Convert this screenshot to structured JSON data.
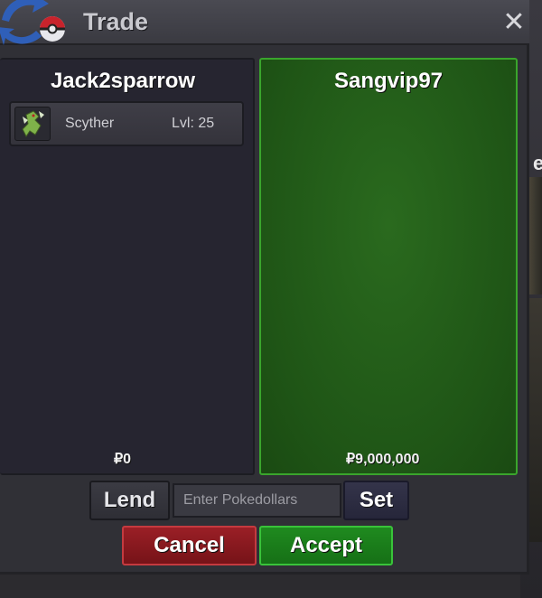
{
  "window": {
    "title": "Trade",
    "close_icon": "close-icon"
  },
  "trade": {
    "left": {
      "player": "Jack2sparrow",
      "items": [
        {
          "icon": "scyther-sprite-icon",
          "name": "Scyther",
          "level": "Lvl: 25"
        }
      ],
      "money": "₽0"
    },
    "right": {
      "player": "Sangvip97",
      "items": [],
      "money": "₽9,000,000"
    }
  },
  "controls": {
    "lend_label": "Lend",
    "money_placeholder": "Enter Pokedollars",
    "set_label": "Set",
    "cancel_label": "Cancel",
    "accept_label": "Accept"
  },
  "peek": {
    "char": "e"
  },
  "colors": {
    "accept_green": "#1f8a1f",
    "cancel_red": "#9a1f26",
    "offer_panel_green": "#2a6a1e"
  }
}
